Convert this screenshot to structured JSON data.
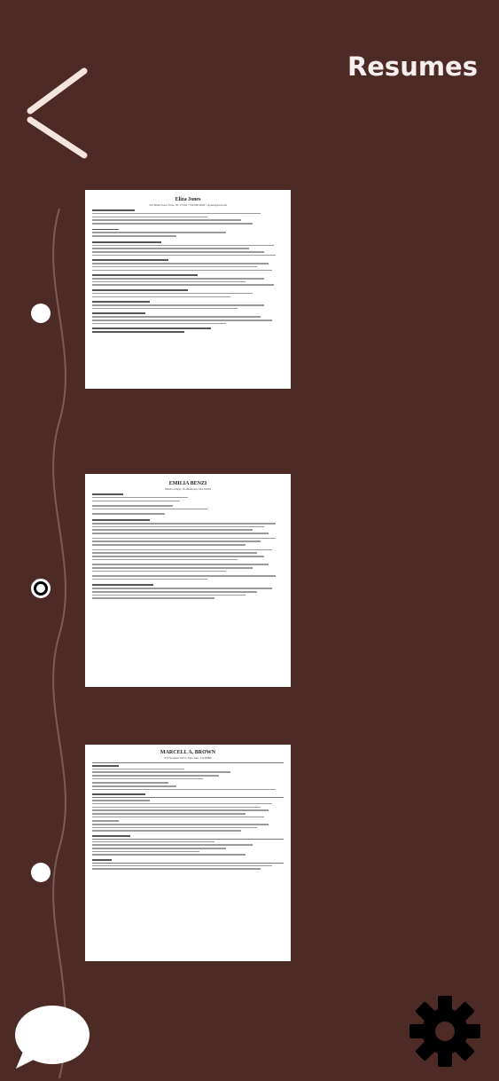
{
  "header": {
    "title": "Resumes"
  },
  "resumes": [
    {
      "name": "Eliza Jones",
      "contact": "100 Main Street, Elon, NC 27244 • 336.000.0000 • ejones@elon.edu",
      "selected": false
    },
    {
      "name": "EMILIA BENZI",
      "contact": "Smith College, Northampton, MA 01063",
      "selected": true
    },
    {
      "name": "MARCELL A. BROWN",
      "contact": "972 Nowhere Drive, Palo Alto, CA 99999",
      "selected": false
    }
  ],
  "colors": {
    "background": "#4e2a27",
    "accent": "#ffffff"
  },
  "icons": {
    "back": "chevron-left-icon",
    "chat": "chat-bubble-icon",
    "settings": "gear-icon"
  }
}
